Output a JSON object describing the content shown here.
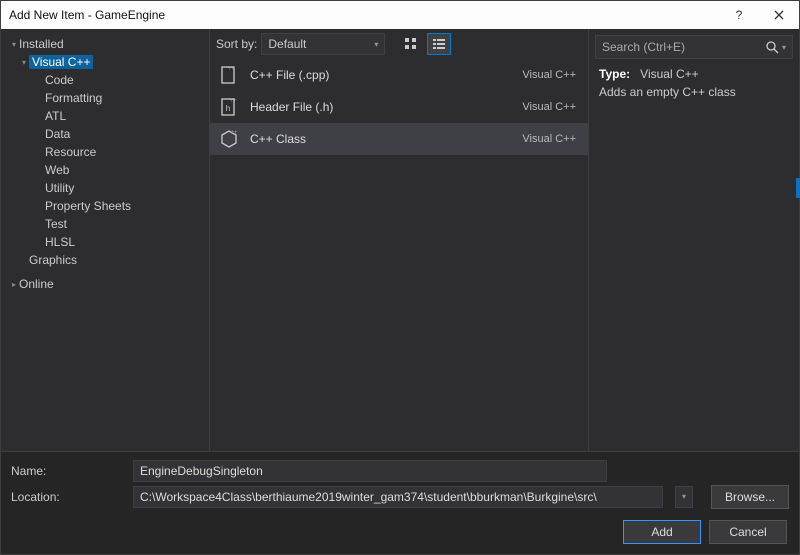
{
  "title": "Add New Item - GameEngine",
  "tree": {
    "installed": "Installed",
    "online": "Online",
    "visual_cpp": "Visual C++",
    "children": [
      "Code",
      "Formatting",
      "ATL",
      "Data",
      "Resource",
      "Web",
      "Utility",
      "Property Sheets",
      "Test",
      "HLSL"
    ],
    "graphics": "Graphics"
  },
  "sort": {
    "label": "Sort by:",
    "value": "Default"
  },
  "items": [
    {
      "name": "C++ File (.cpp)",
      "type": "Visual C++"
    },
    {
      "name": "Header File (.h)",
      "type": "Visual C++"
    },
    {
      "name": "C++ Class",
      "type": "Visual C++"
    }
  ],
  "selected_item_index": 2,
  "search_placeholder": "Search (Ctrl+E)",
  "info": {
    "type_label": "Type:",
    "type_value": "Visual C++",
    "description": "Adds an empty C++ class"
  },
  "form": {
    "name_label": "Name:",
    "name_value": "EngineDebugSingleton",
    "location_label": "Location:",
    "location_value": "C:\\Workspace4Class\\berthiaume2019winter_gam374\\student\\bburkman\\Burkgine\\src\\",
    "browse": "Browse..."
  },
  "buttons": {
    "add": "Add",
    "cancel": "Cancel"
  }
}
